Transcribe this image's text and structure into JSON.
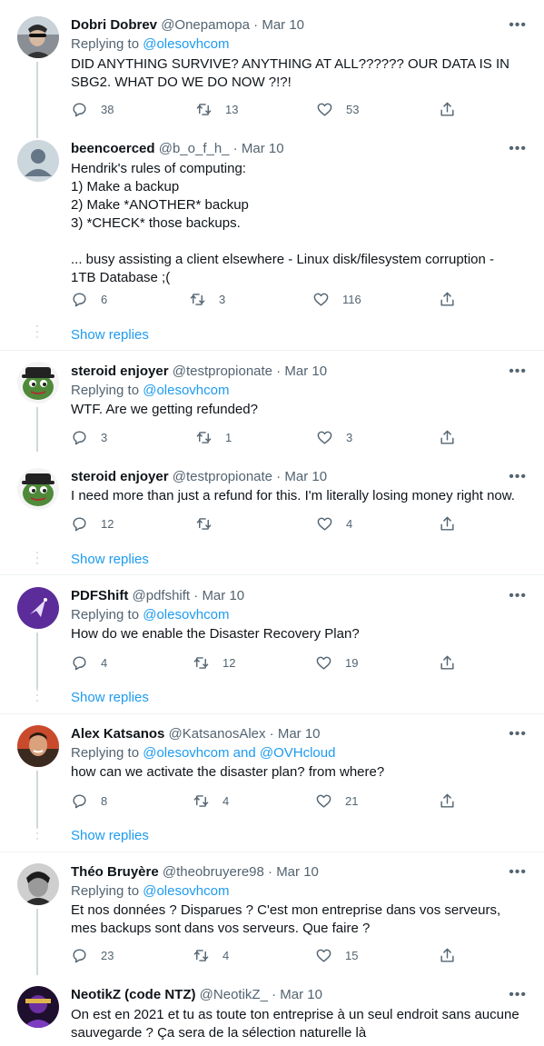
{
  "tweets": [
    {
      "name": "Dobri Dobrev",
      "handle": "@Onepamopa",
      "date": "Mar 10",
      "replying_label": "Replying to ",
      "replying_to": "@olesovhcom",
      "lines": [
        "DID ANYTHING SURVIVE? ANYTHING AT ALL?????? OUR DATA IS IN",
        "SBG2. WHAT DO WE DO NOW ?!?!"
      ],
      "replies": "38",
      "retweets": "13",
      "likes": "53"
    },
    {
      "name": "beencoerced",
      "handle": "@b_o_f_h_",
      "date": "Mar 10",
      "lines": [
        "Hendrik's rules of computing:",
        "1) Make a backup",
        "2) Make *ANOTHER* backup",
        "3) *CHECK* those backups.",
        "",
        "... busy assisting a client elsewhere - Linux disk/filesystem corruption -",
        "1TB Database ;("
      ],
      "replies": "6",
      "retweets": "3",
      "likes": "116",
      "show_replies": "Show replies"
    },
    {
      "name": "steroid enjoyer",
      "handle": "@testpropionate",
      "date": "Mar 10",
      "replying_label": "Replying to ",
      "replying_to": "@olesovhcom",
      "lines": [
        "WTF. Are we getting refunded?"
      ],
      "replies": "3",
      "retweets": "1",
      "likes": "3"
    },
    {
      "name": "steroid enjoyer",
      "handle": "@testpropionate",
      "date": "Mar 10",
      "lines": [
        "I need more than just a refund for this. I'm literally losing money right now."
      ],
      "replies": "12",
      "retweets": "",
      "likes": "4",
      "show_replies": "Show replies"
    },
    {
      "name": "PDFShift",
      "handle": "@pdfshift",
      "date": "Mar 10",
      "replying_label": "Replying to ",
      "replying_to": "@olesovhcom",
      "lines": [
        "How do we enable the Disaster Recovery Plan?"
      ],
      "replies": "4",
      "retweets": "12",
      "likes": "19",
      "show_replies": "Show replies"
    },
    {
      "name": "Alex Katsanos",
      "handle": "@KatsanosAlex",
      "date": "Mar 10",
      "replying_label": "Replying to ",
      "replying_to": "@olesovhcom and @OVHcloud",
      "lines": [
        "how can we activate the disaster plan? from where?"
      ],
      "replies": "8",
      "retweets": "4",
      "likes": "21",
      "show_replies": "Show replies"
    },
    {
      "name": "Théo Bruyère",
      "handle": "@theobruyere98",
      "date": "Mar 10",
      "replying_label": "Replying to ",
      "replying_to": "@olesovhcom",
      "lines": [
        "Et nos données ? Disparues ? C'est mon entreprise dans vos serveurs,",
        "mes backups sont dans vos serveurs. Que faire ?"
      ],
      "replies": "23",
      "retweets": "4",
      "likes": "15"
    },
    {
      "name": "NeotikZ (code NTZ)",
      "handle": "@NeotikZ_",
      "date": "Mar 10",
      "lines": [
        "On est en 2021 et tu as toute ton entreprise à un seul endroit sans aucune",
        "sauvegarde ? Ça sera de la sélection naturelle là"
      ]
    }
  ],
  "separator": " · ",
  "colors": {
    "link": "#1d9bf0",
    "muted": "#536471",
    "line": "#cfd9de"
  },
  "icons": [
    "reply-icon",
    "retweet-icon",
    "like-icon",
    "share-icon",
    "more-icon",
    "avatar-placeholder"
  ]
}
